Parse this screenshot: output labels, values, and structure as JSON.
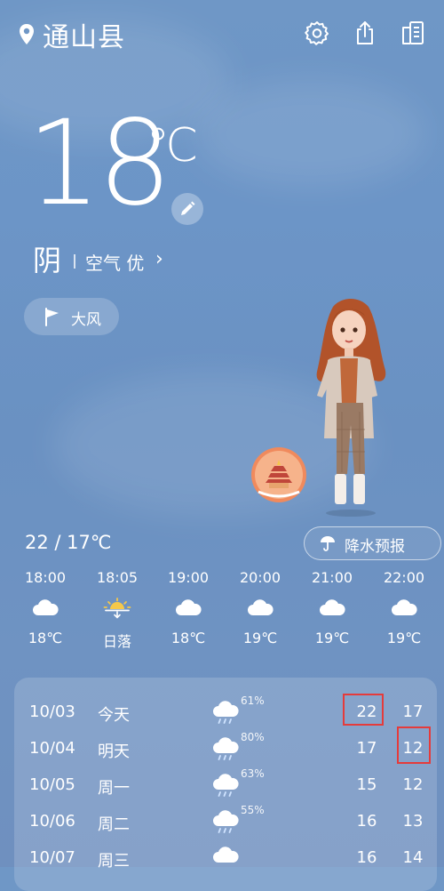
{
  "header": {
    "city": "通山县",
    "icons": [
      "location-pin-icon",
      "settings-gear-icon",
      "share-icon",
      "news-icon"
    ]
  },
  "current": {
    "temperature": "18",
    "unit": "℃",
    "condition": "阴",
    "air_quality": "空气 优",
    "alert": "大风"
  },
  "today": {
    "range": "22 / 17℃",
    "precip_button": "降水预报"
  },
  "hourly": [
    {
      "time": "18:00",
      "icon": "cloud-icon",
      "temp": "18℃"
    },
    {
      "time": "18:05",
      "icon": "sunset-icon",
      "temp": "日落"
    },
    {
      "time": "19:00",
      "icon": "cloud-icon",
      "temp": "18℃"
    },
    {
      "time": "20:00",
      "icon": "cloud-icon",
      "temp": "19℃"
    },
    {
      "time": "21:00",
      "icon": "cloud-icon",
      "temp": "19℃"
    },
    {
      "time": "22:00",
      "icon": "cloud-icon",
      "temp": "19℃"
    }
  ],
  "daily": [
    {
      "date": "10/03",
      "day": "今天",
      "icon": "rain-cloud-icon",
      "pct": "61%",
      "high": "22",
      "low": "17"
    },
    {
      "date": "10/04",
      "day": "明天",
      "icon": "rain-cloud-icon",
      "pct": "80%",
      "high": "17",
      "low": "12"
    },
    {
      "date": "10/05",
      "day": "周一",
      "icon": "rain-cloud-icon",
      "pct": "63%",
      "high": "15",
      "low": "12"
    },
    {
      "date": "10/06",
      "day": "周二",
      "icon": "rain-cloud-icon",
      "pct": "55%",
      "high": "16",
      "low": "13"
    },
    {
      "date": "10/07",
      "day": "周三",
      "icon": "cloud-icon",
      "pct": "",
      "high": "16",
      "low": "14"
    }
  ],
  "colors": {
    "background": "#6c95c7",
    "highlight_box": "#e53b3b",
    "sun": "#f5c84a"
  }
}
